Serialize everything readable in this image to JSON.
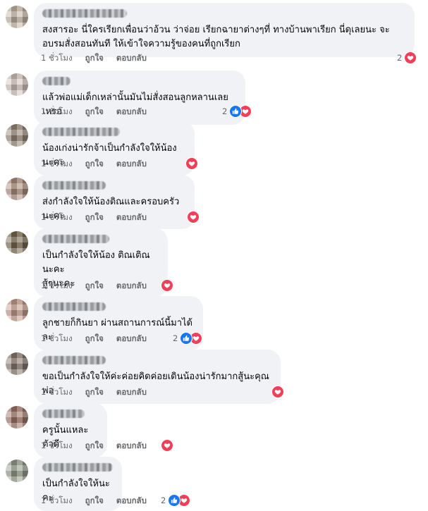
{
  "colors": {
    "heart": "#f33e58",
    "like": "#1877f2",
    "bubble": "#f0f2f5",
    "meta": "#65676b"
  },
  "labels": {
    "like": "ถูกใจ",
    "reply": "ตอบกลับ"
  },
  "comments": [
    {
      "text": "สงสารอะ นี่ใครเรียกเพื่อนว่าอ้วน ว่าจ่อย เรียกฉายาต่างๆที่ ทางบ้านพาเรียก นี่ดุเลยนะ จะอบรมสั่งสอนทันที ให้เข้าใจความรู้ของคนที่ถูกเรียก",
      "time": "1 ชั่วโมง",
      "reaction_count": "2",
      "reactions": [
        "heart"
      ]
    },
    {
      "text": "แล้วพ่อแม่เด็กเหล่านั้นมันไม่สั่งสอนลูกหลานเลยเหรอ",
      "time": "1 ชั่วโมง",
      "reaction_count": "2",
      "reactions": [
        "like",
        "heart"
      ]
    },
    {
      "text": "น้องเก่งน่ารักจ้าเป็นกำลังใจให้น้องนะคะ",
      "time": "1 ชั่วโมง",
      "reaction_count": "",
      "reactions": [
        "heart"
      ]
    },
    {
      "text": "ส่งกำลังใจให้น้องติณและครอบครัวนะคะ",
      "time": "1 ชั่วโมง",
      "reaction_count": "",
      "reactions": [
        "heart"
      ]
    },
    {
      "text": "เป็นกำลังใจให้น้อง ติณเติณนะคะ\nสู้ๆนะคะ",
      "time": "1 ชั่วโมง",
      "reaction_count": "",
      "reactions": [
        "heart"
      ]
    },
    {
      "text": "ลูกชายก็กินยา ผ่านสถานการณ์นี้มาได้ละ",
      "time": "1 ชั่วโมง",
      "reaction_count": "2",
      "reactions": [
        "like",
        "heart"
      ]
    },
    {
      "text": "ขอเป็นกำลังใจให้ค่ะค่อยคิดค่อยเดินน้องน่ารักมากสู้นะคุณพ่อ",
      "time": "1 ชั่วโมง",
      "reaction_count": "",
      "reactions": [
        "heart"
      ]
    },
    {
      "text": "ครูนั้นแหละตัวดี",
      "time": "1 ชั่วโมง",
      "reaction_count": "",
      "reactions": [
        "heart"
      ]
    },
    {
      "text": "เป็นกำลังใจให้นะคะ",
      "time": "1 ชั่วโมง",
      "reaction_count": "2",
      "reactions": [
        "like",
        "heart"
      ]
    }
  ]
}
